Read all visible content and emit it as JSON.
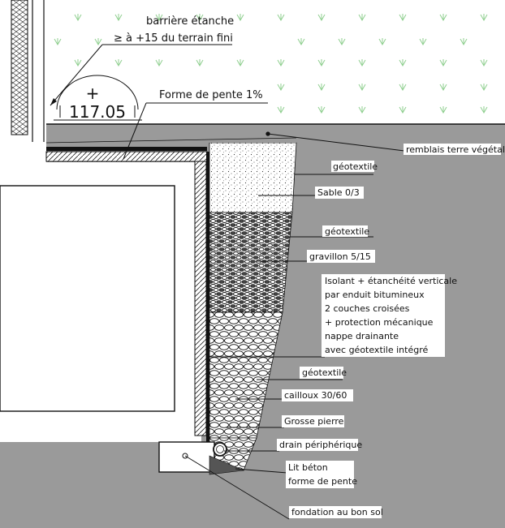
{
  "diagram": {
    "top_note_line1": "barrière étanche",
    "top_note_line2": "≥ à +15 du terrain fini",
    "elevation_sign": "+",
    "elevation_value": "117.05",
    "slope_note": "Forme de pente 1%",
    "labels": {
      "remblais": "remblais terre végétale",
      "geotextile_1": "géotextile",
      "sable": "Sable 0/3",
      "geotextile_2": "géotextile",
      "gravillon": "gravillon 5/15",
      "isolant_1": "Isolant + étanchéité verticale",
      "isolant_2": "par enduit bitumineux",
      "isolant_3": "2 couches croisées",
      "isolant_4": "+ protection mécanique",
      "isolant_5": "nappe drainante",
      "isolant_6": "avec géotextile intégré",
      "geotextile_3": "géotextile",
      "cailloux": "cailloux 30/60",
      "grosse_pierre": "Grosse pierre",
      "drain": "drain périphérique",
      "lit_1": "Lit béton",
      "lit_2": "forme de pente",
      "fondation": "fondation au bon sol"
    },
    "colors": {
      "soil": "#9a9a9a",
      "wall_fill": "#ffffff",
      "grass": "#8fcf8f",
      "line": "#111111"
    }
  }
}
